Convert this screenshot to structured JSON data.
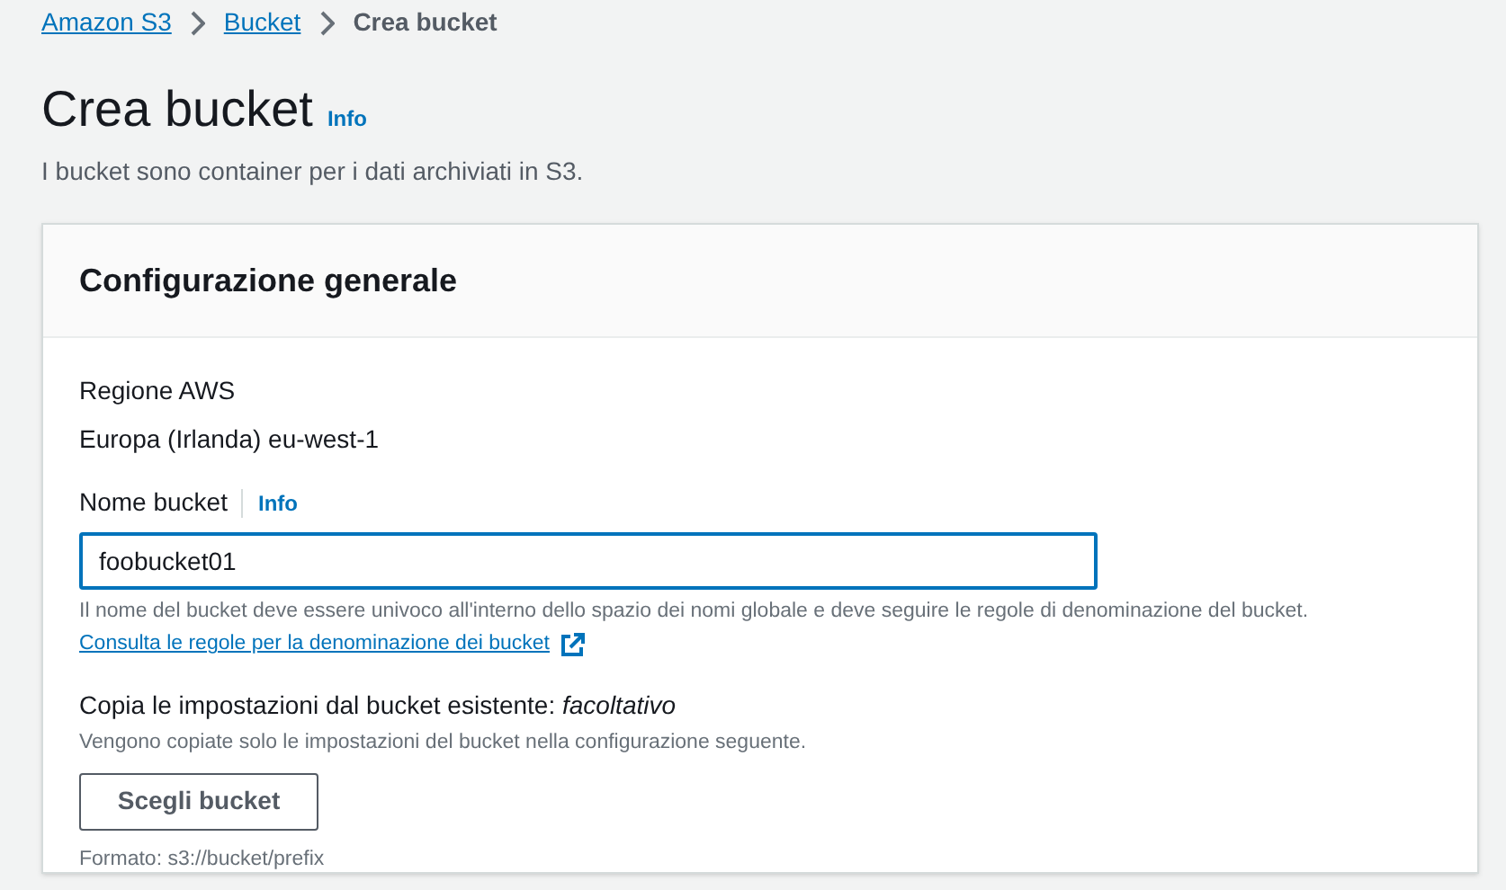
{
  "breadcrumbs": [
    {
      "label": "Amazon S3",
      "kind": "link"
    },
    {
      "label": "Bucket",
      "kind": "link"
    },
    {
      "label": "Crea bucket",
      "kind": "current"
    }
  ],
  "page": {
    "title": "Crea bucket",
    "info": "Info",
    "description": "I bucket sono container per i dati archiviati in S3."
  },
  "panel": {
    "title": "Configurazione generale",
    "region": {
      "label": "Regione AWS",
      "value": "Europa (Irlanda) eu-west-1"
    },
    "bucket_name": {
      "label": "Nome bucket",
      "info": "Info",
      "value": "foobucket01",
      "hint": "Il nome del bucket deve essere univoco all'interno dello spazio dei nomi globale e deve seguire le regole di denominazione del bucket.",
      "link": "Consulta le regole per la denominazione dei bucket"
    },
    "copy_settings": {
      "label": "Copia le impostazioni dal bucket esistente: *facoltativo*",
      "description": "Vengono copiate solo le impostazioni del bucket nella configurazione seguente.",
      "button": "Scegli bucket",
      "format": "Formato: s3://bucket/prefix"
    }
  }
}
